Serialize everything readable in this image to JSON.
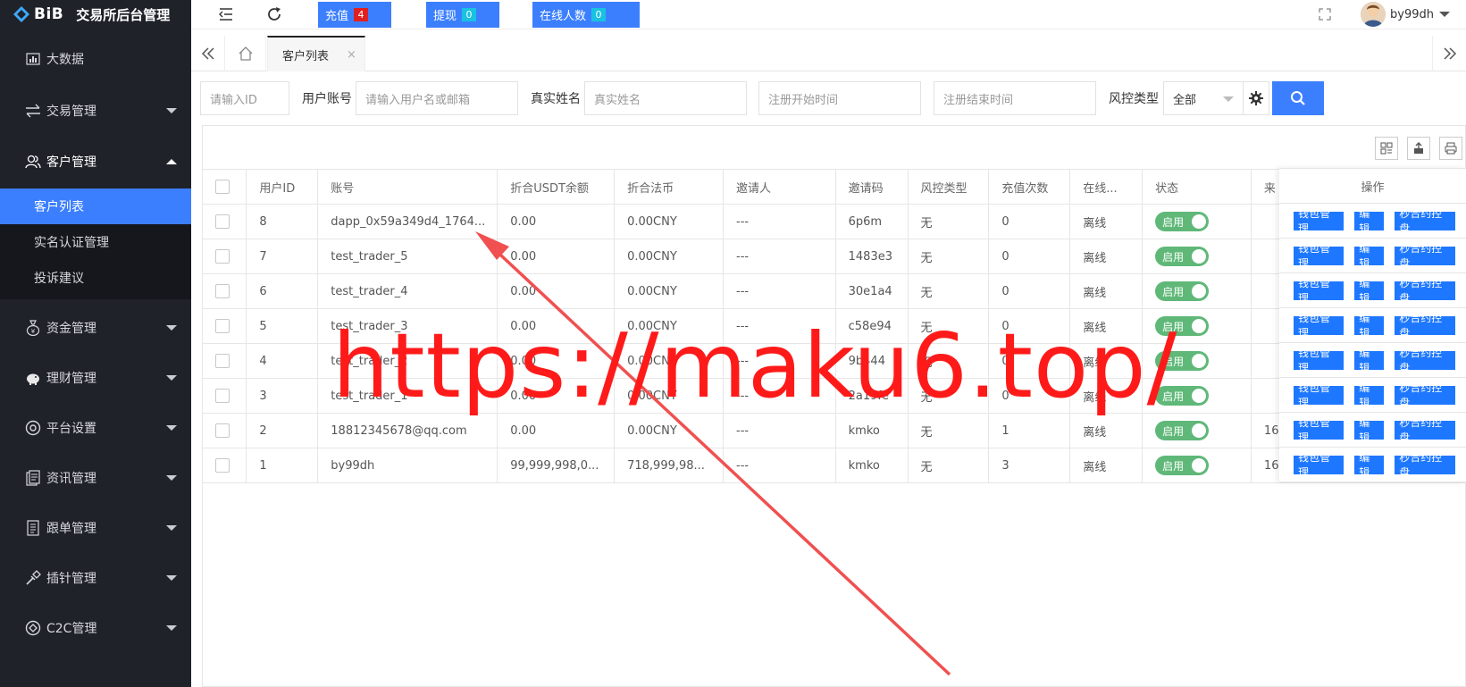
{
  "brand": {
    "logo_text": "BiB",
    "app_title": "交易所后台管理"
  },
  "sidebar": {
    "items": [
      {
        "label": "大数据",
        "icon": "chart-icon",
        "has_caret": false
      },
      {
        "label": "交易管理",
        "icon": "exchange-icon",
        "has_caret": true
      },
      {
        "label": "客户管理",
        "icon": "users-icon",
        "has_caret": true,
        "open": true
      },
      {
        "label": "资金管理",
        "icon": "money-bag-icon",
        "has_caret": true
      },
      {
        "label": "理财管理",
        "icon": "piggy-bank-icon",
        "has_caret": true
      },
      {
        "label": "平台设置",
        "icon": "settings-circle-icon",
        "has_caret": true
      },
      {
        "label": "资讯管理",
        "icon": "news-icon",
        "has_caret": true
      },
      {
        "label": "跟单管理",
        "icon": "document-icon",
        "has_caret": true
      },
      {
        "label": "插针管理",
        "icon": "pin-tool-icon",
        "has_caret": true
      },
      {
        "label": "C2C管理",
        "icon": "c2c-icon",
        "has_caret": true
      }
    ],
    "submenu": [
      {
        "label": "客户列表",
        "active": true
      },
      {
        "label": "实名认证管理",
        "active": false
      },
      {
        "label": "投诉建议",
        "active": false
      }
    ]
  },
  "topbar": {
    "recharge_label": "充值",
    "recharge_count": "4",
    "withdraw_label": "提现",
    "withdraw_count": "0",
    "online_label": "在线人数",
    "online_count": "0",
    "username": "by99dh"
  },
  "tabs": {
    "active_label": "客户列表",
    "close_symbol": "×"
  },
  "filters": {
    "id_placeholder": "请输入ID",
    "account_label": "用户账号",
    "account_placeholder": "请输入用户名或邮箱",
    "realname_label": "真实姓名",
    "realname_placeholder": "真实姓名",
    "reg_start_placeholder": "注册开始时间",
    "reg_end_placeholder": "注册结束时间",
    "risk_label": "风控类型",
    "risk_value": "全部"
  },
  "table": {
    "headers": [
      "用户ID",
      "账号",
      "折合USDT余额",
      "折合法币",
      "邀请人",
      "邀请码",
      "风控类型",
      "充值次数",
      "在线...",
      "状态",
      "来"
    ],
    "ops_header": "操作",
    "status_label": "启用",
    "op_buttons": [
      "钱包管理",
      "编辑",
      "秒合约控盘"
    ],
    "rows": [
      [
        "8",
        "dapp_0x59a349d4_1764...",
        "0.00",
        "0.00CNY",
        "---",
        "6p6m",
        "无",
        "0",
        "离线",
        ""
      ],
      [
        "7",
        "test_trader_5",
        "0.00",
        "0.00CNY",
        "---",
        "1483e3",
        "无",
        "0",
        "离线",
        ""
      ],
      [
        "6",
        "test_trader_4",
        "0.00",
        "0.00CNY",
        "---",
        "30e1a4",
        "无",
        "0",
        "离线",
        ""
      ],
      [
        "5",
        "test_trader_3",
        "0.00",
        "0.00CNY",
        "---",
        "c58e94",
        "无",
        "0",
        "离线",
        ""
      ],
      [
        "4",
        "test_trader_2",
        "0.00",
        "0.00CNY",
        "---",
        "9b444",
        "无",
        "0",
        "离线",
        ""
      ],
      [
        "3",
        "test_trader_1",
        "0.00",
        "0.00CNY",
        "---",
        "2a19fe",
        "无",
        "0",
        "离线",
        ""
      ],
      [
        "2",
        "18812345678@qq.com",
        "0.00",
        "0.00CNY",
        "---",
        "kmko",
        "无",
        "1",
        "离线",
        "16"
      ],
      [
        "1",
        "by99dh",
        "99,999,998,0...",
        "718,999,98...",
        "---",
        "kmko",
        "无",
        "3",
        "离线",
        "16"
      ]
    ]
  },
  "watermark": {
    "text": "https://maku6.top/",
    "color": "#ff1a1a"
  },
  "colors": {
    "primary": "#3c7ffe",
    "sidebar": "#20222a",
    "toggle_on": "#5fb878",
    "badge_red": "#e02020",
    "badge_cyan": "#19c2e0",
    "arrow": "#f05050"
  }
}
